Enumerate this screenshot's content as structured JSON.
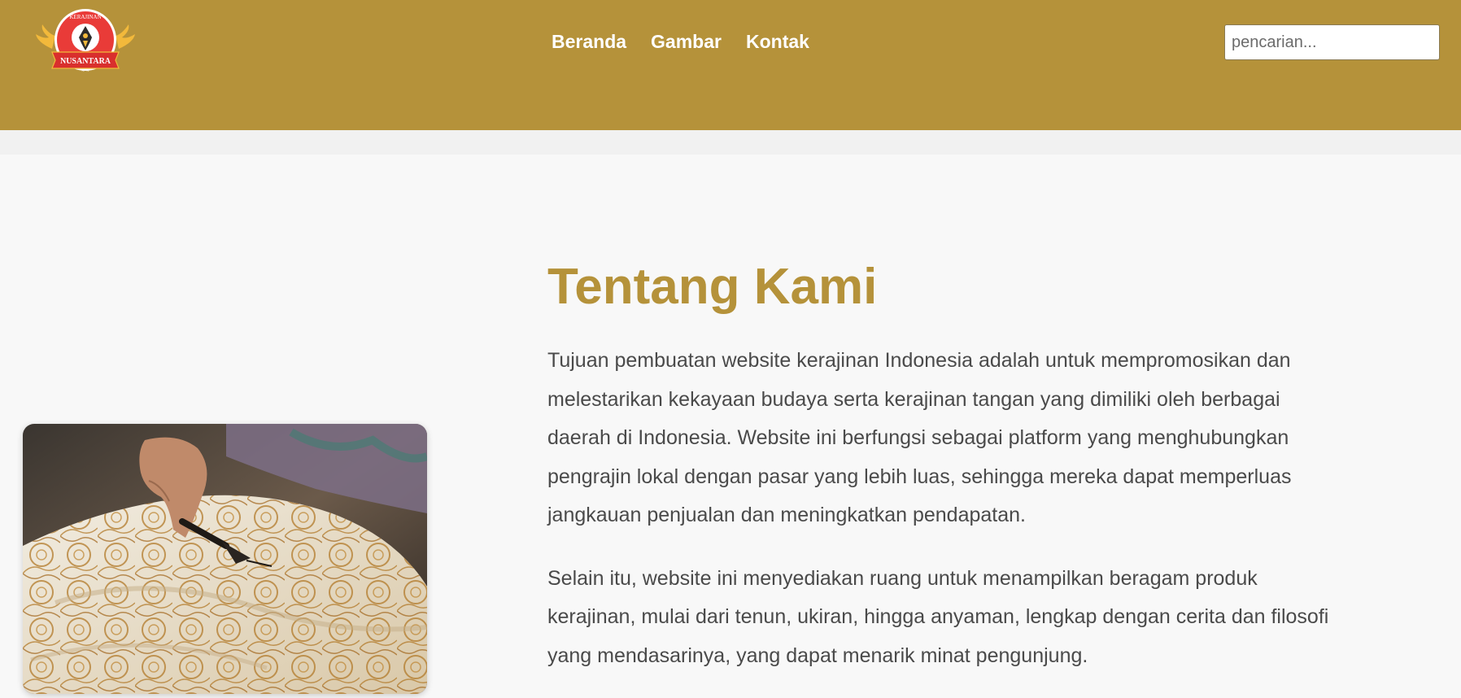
{
  "header": {
    "logo": {
      "text_top": "KERAJINAN",
      "text_banner": "NUSANTARA",
      "colors": {
        "red": "#e93b38",
        "gold": "#f2b93b",
        "dark": "#2b2b2b"
      }
    },
    "nav": [
      {
        "label": "Beranda"
      },
      {
        "label": "Gambar"
      },
      {
        "label": "Kontak"
      }
    ],
    "search": {
      "placeholder": "pencarian...",
      "value": ""
    },
    "background_color": "#b5923a"
  },
  "about": {
    "title": "Tentang Kami",
    "paragraphs": [
      "Tujuan pembuatan website kerajinan Indonesia adalah untuk mempromosikan dan melestarikan kekayaan budaya serta kerajinan tangan yang dimiliki oleh berbagai daerah di Indonesia. Website ini berfungsi sebagai platform yang menghubungkan pengrajin lokal dengan pasar yang lebih luas, sehingga mereka dapat memperluas jangkauan penjualan dan meningkatkan pendapatan.",
      "Selain itu, website ini menyediakan ruang untuk menampilkan beragam produk kerajinan, mulai dari tenun, ukiran, hingga anyaman, lengkap dengan cerita dan filosofi yang mendasarinya, yang dapat menarik minat pengunjung."
    ],
    "title_color": "#b5923a",
    "text_color": "#4a4a4a"
  },
  "image": {
    "subject": "batik-canting-photo"
  }
}
